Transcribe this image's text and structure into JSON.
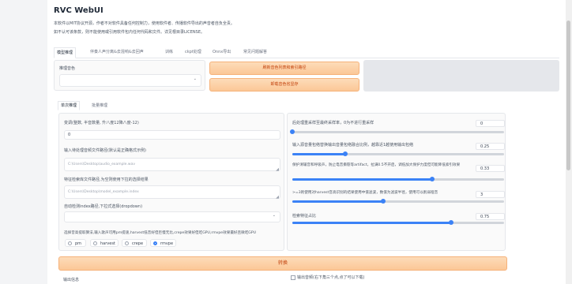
{
  "app": {
    "title": "RVC WebUI",
    "description_line1": "本软件以MIT协议开源，作者不对软件具备任何控制力，使用软件者、传播软件导出的声音者自负全责。",
    "description_line2": "如不认可该条款，则不能使用或引用软件包内任何代码和文件。详见根目录LICENSE。"
  },
  "tabs": [
    {
      "label": "模型推理",
      "active": true
    },
    {
      "label": "伴奏人声分离&去混响&去回声",
      "active": false
    },
    {
      "label": "训练",
      "active": false
    },
    {
      "label": "ckpt处理",
      "active": false
    },
    {
      "label": "Onnx导出",
      "active": false
    },
    {
      "label": "常见问题解答",
      "active": false
    }
  ],
  "inference": {
    "voice_label": "推理音色",
    "refresh_button": "刷新音色列表和索引路径",
    "unload_button": "卸载音色省显存",
    "subtabs": [
      {
        "label": "单次推理",
        "active": true
      },
      {
        "label": "批量推理",
        "active": false
      }
    ],
    "transpose_label": "变调(整数, 半音数量, 升八度12降八度-12)",
    "transpose_value": "0",
    "input_path_label": "输入待处理音频文件路径(默认是正确格式示例)",
    "input_path_placeholder": "C:\\Users\\Desktop\\audio_example.wav",
    "index_path_label": "特征检索库文件路径,为空则使用下拉的选择结果",
    "index_path_placeholder": "C:\\Users\\Desktop\\model_example.index",
    "auto_index_label": "自动检测index路径,下拉式选择(dropdown)",
    "f0_method_label": "选择音高提取算法,输入歌声可用pm提速,harvest低音好但巨慢无比,crepe效果好但吃GPU,rmvpe效果最好且微吃GPU",
    "f0_methods": [
      {
        "label": "pm",
        "selected": false
      },
      {
        "label": "harvest",
        "selected": false
      },
      {
        "label": "crepe",
        "selected": false
      },
      {
        "label": "rmvpe",
        "selected": true
      }
    ],
    "convert_button": "转换",
    "output_info_label": "输出信息",
    "output_audio_label": "输出音频(右下角三个点,点了可以下载)"
  },
  "params": [
    {
      "label": "后处理重采样至最终采样率，0为不进行重采样",
      "value": "0",
      "fraction": 0.0
    },
    {
      "label": "输入源音量包络替换输出音量包络融合比例，越靠近1越使用输出包络",
      "value": "0.25",
      "fraction": 0.25
    },
    {
      "label": "保护清辅音和呼吸声，防止电音撕裂等artifact，拉满0.5不开启，调低加大保护力度但可能降低索引效果",
      "value": "0.33",
      "fraction": 0.66
    },
    {
      "label": ">=3则使用对harvest音高识别的结果使用中值滤波，数值为滤波半径，使用可以削弱哑音",
      "value": "3",
      "fraction": 0.43
    },
    {
      "label": "检索特征占比",
      "value": "0.75",
      "fraction": 0.75
    }
  ],
  "colors": {
    "accent": "#3b82f6",
    "button": "#fbc797",
    "button_text": "#c2410c"
  }
}
